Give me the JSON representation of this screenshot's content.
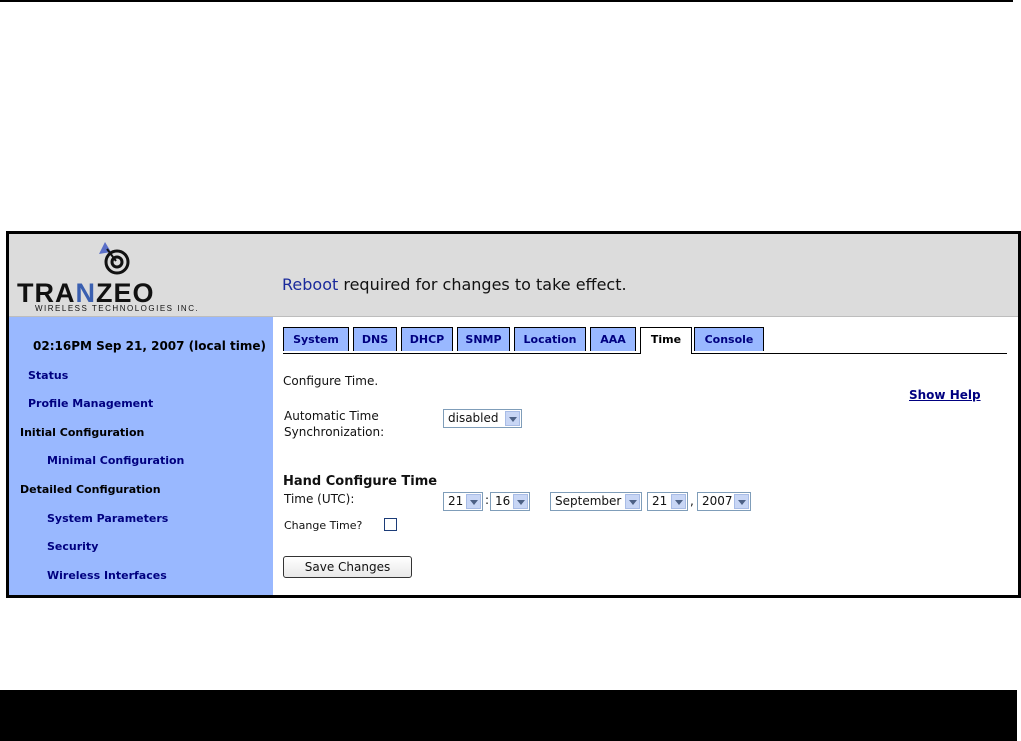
{
  "header": {
    "logo_text": "TRANZEO",
    "logo_sub": "WIRELESS TECHNOLOGIES INC.",
    "reboot_link": "Reboot",
    "reboot_msg": " required for changes to take effect."
  },
  "sidebar": {
    "datetime": "02:16PM Sep 21, 2007 (local time)",
    "status": "Status",
    "profile_management": "Profile Management",
    "initial_configuration": "Initial Configuration",
    "minimal_configuration": "Minimal Configuration",
    "detailed_configuration": "Detailed Configuration",
    "system_parameters": "System Parameters",
    "security": "Security",
    "wireless_interfaces": "Wireless Interfaces"
  },
  "tabs": [
    "System",
    "DNS",
    "DHCP",
    "SNMP",
    "Location",
    "AAA",
    "Time",
    "Console"
  ],
  "active_tab": "Time",
  "content": {
    "intro": "Configure Time.",
    "show_help": "Show Help",
    "auto_sync_label_1": "Automatic Time",
    "auto_sync_label_2": "Synchronization:",
    "auto_sync_value": "disabled",
    "hand_title": "Hand Configure Time",
    "time_label": "Time (UTC):",
    "hour": "21",
    "minute": "16",
    "colon": ":",
    "month": "September",
    "day": "21",
    "comma": ",",
    "year": "2007",
    "change_time_label": "Change Time?",
    "change_time_checked": false,
    "save_label": "Save Changes"
  },
  "colors": {
    "sidebar_bg": "#99b8ff",
    "link": "#000080",
    "header_bg": "#dcdcdc"
  }
}
